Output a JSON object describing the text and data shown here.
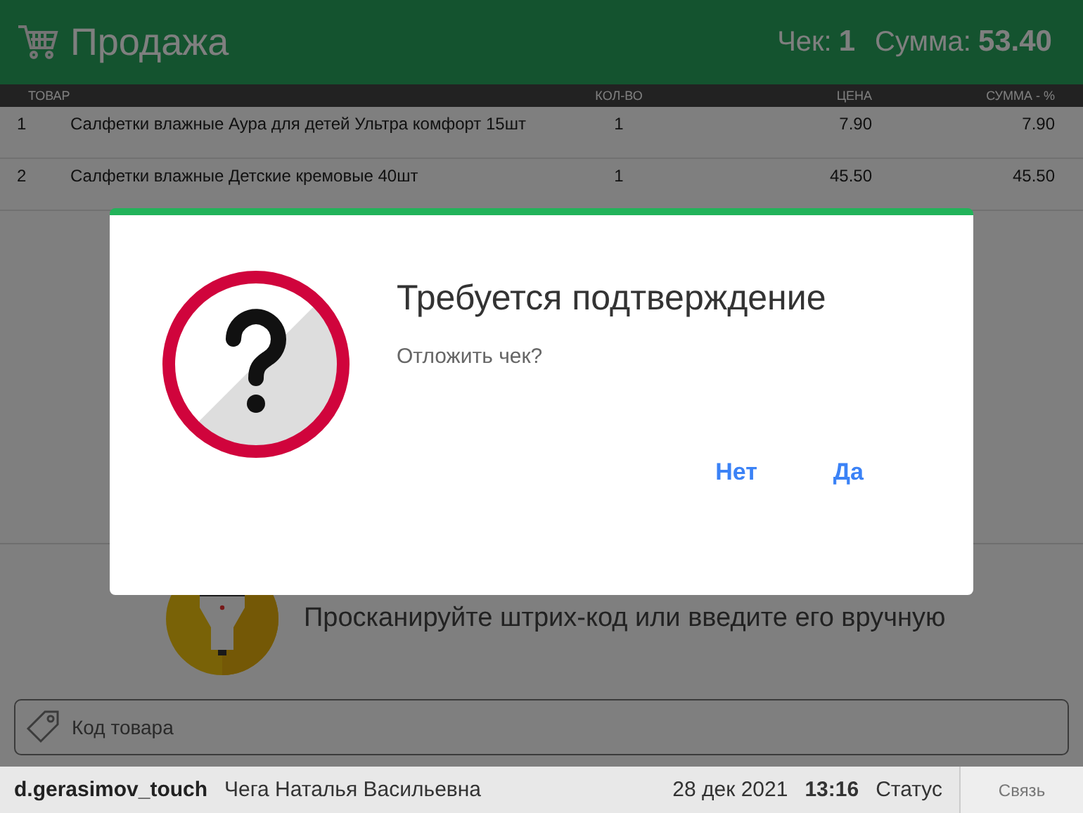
{
  "header": {
    "title": "Продажа",
    "receipt_label": "Чек:",
    "receipt_number": "1",
    "sum_label": "Сумма:",
    "sum_value": "53.40"
  },
  "table": {
    "columns": [
      "ТОВАР",
      "КОЛ-ВО",
      "ЦЕНА",
      "СУММА - %"
    ],
    "rows": [
      {
        "number": "1",
        "name": "Салфетки влажные Аура для детей Ультра комфорт 15шт",
        "quantity": "1",
        "price": "7.90",
        "total": "7.90"
      },
      {
        "number": "2",
        "name": "Салфетки влажные Детские кремовые 40шт",
        "quantity": "1",
        "price": "45.50",
        "total": "45.50"
      }
    ]
  },
  "scan_hint": "Просканируйте штрих-код или введите его вручную",
  "code_field": {
    "placeholder": "Код товара"
  },
  "status_bar": {
    "user": "d.gerasimov_touch",
    "cashier": "Чега Наталья Васильевна",
    "date": "28 дек 2021",
    "time": "13:16",
    "status": "Статус",
    "link": "Связь"
  },
  "dialog": {
    "title": "Требуется подтверждение",
    "message": "Отложить чек?",
    "buttons": [
      "Нет",
      "Да"
    ]
  }
}
